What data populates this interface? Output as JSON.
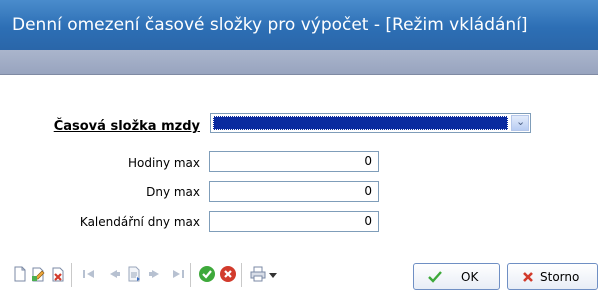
{
  "window": {
    "title": "Denní omezení časové složky pro výpočet - [Režim vkládání]"
  },
  "form": {
    "time_component_label": "Časová složka mzdy",
    "hours_max_label": "Hodiny max",
    "hours_max_value": "0",
    "days_max_label": "Dny max",
    "days_max_value": "0",
    "calendar_days_max_label": "Kalendářní dny max",
    "calendar_days_max_value": "0"
  },
  "toolbar": {
    "icons": [
      "new-document-icon",
      "edit-document-icon",
      "delete-document-icon",
      "first-record-icon",
      "previous-record-icon",
      "record-detail-icon",
      "next-record-icon",
      "last-record-icon",
      "confirm-icon",
      "cancel-icon",
      "print-icon"
    ],
    "ok_label": "OK",
    "storno_label": "Storno"
  },
  "colors": {
    "title_bar": "#2d6fb5",
    "selection": "#0a2a9f",
    "confirm": "#3ea93b",
    "cancel": "#d23b2c"
  }
}
